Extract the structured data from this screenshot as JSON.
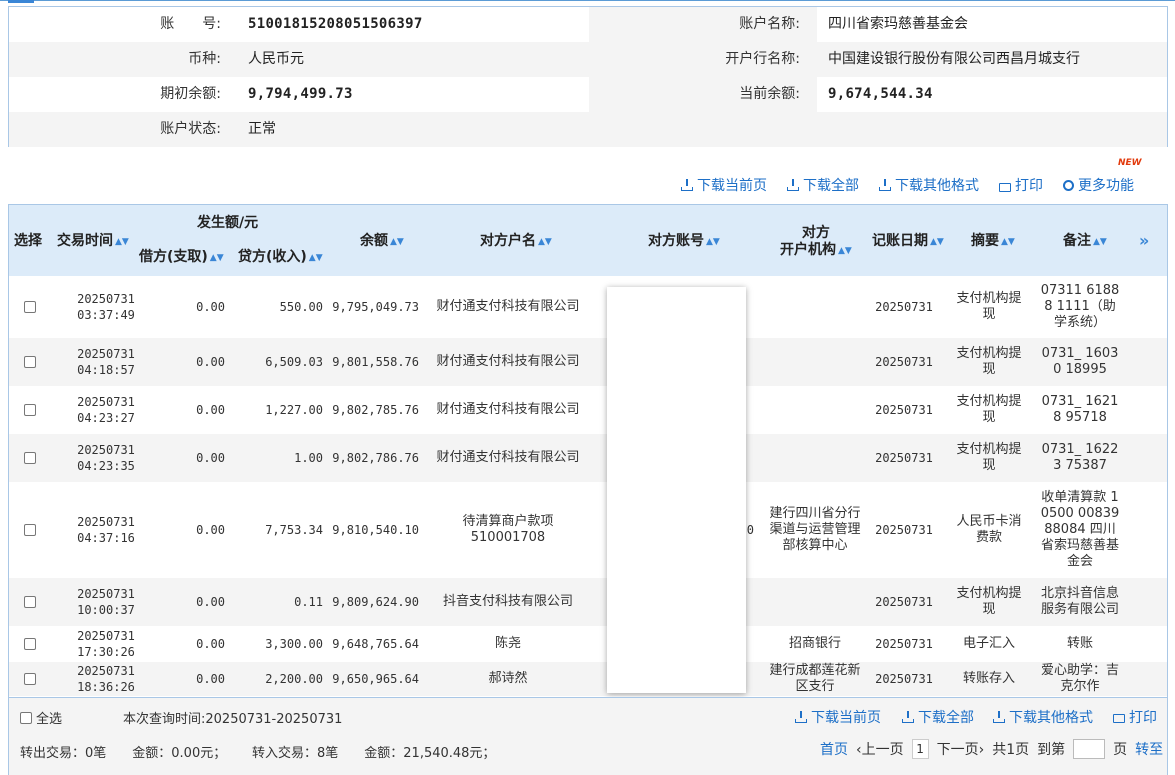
{
  "account": {
    "account_no_label": "账　　号:",
    "account_no": "510018152080515063​97",
    "account_name_label": "账户名称:",
    "account_name": "四川省索玛慈善基金会",
    "currency_label": "币种:",
    "currency": "人民币元",
    "bank_label": "开户行名称:",
    "bank": "中国建设银行股份有限公司西昌月城支行",
    "opening_label": "期初余额:",
    "opening": "9,794,499.73",
    "current_label": "当前余额:",
    "current": "9,674,544.34",
    "status_label": "账户状态:",
    "status": "正常"
  },
  "toolbar": {
    "download_page": "下载当前页",
    "download_all": "下载全部",
    "download_other": "下载其他格式",
    "print": "打印",
    "more": "更多功能",
    "new_badge": "NEW"
  },
  "table": {
    "headers": {
      "select": "选择",
      "time": "交易时间",
      "amount_group": "发生额/元",
      "debit": "借方(支取)",
      "credit": "贷方(收入)",
      "balance": "余额",
      "counterparty": "对方户名",
      "cp_account": "对方账号",
      "cp_bank_line1": "对方",
      "cp_bank_line2": "开户机构",
      "date": "记账日期",
      "summary": "摘要",
      "remark": "备注",
      "sort_glyph": "▲▼",
      "expand": "»"
    },
    "rows": [
      {
        "date": "20250731",
        "time": "03:37:49",
        "debit": "0.00",
        "credit": "550.00",
        "balance": "9,795,049.73",
        "counterparty": "财付通支付科技有限公司",
        "bank": "",
        "book_date": "20250731",
        "summary": "支付机构提现",
        "remark": "07311 61888 1111（助学系统）"
      },
      {
        "date": "20250731",
        "time": "04:18:57",
        "debit": "0.00",
        "credit": "6,509.03",
        "balance": "9,801,558.76",
        "counterparty": "财付通支付科技有限公司",
        "bank": "",
        "book_date": "20250731",
        "summary": "支付机构提现",
        "remark": "0731_ 16030 18995"
      },
      {
        "date": "20250731",
        "time": "04:23:27",
        "debit": "0.00",
        "credit": "1,227.00",
        "balance": "9,802,785.76",
        "counterparty": "财付通支付科技有限公司",
        "bank": "",
        "book_date": "20250731",
        "summary": "支付机构提现",
        "remark": "0731_ 16218 95718"
      },
      {
        "date": "20250731",
        "time": "04:23:35",
        "debit": "0.00",
        "credit": "1.00",
        "balance": "9,802,786.76",
        "counterparty": "财付通支付科技有限公司",
        "bank": "",
        "book_date": "20250731",
        "summary": "支付机构提现",
        "remark": "0731_ 16223 75387"
      },
      {
        "date": "20250731",
        "time": "04:37:16",
        "debit": "0.00",
        "credit": "7,753.34",
        "balance": "9,810,540.10",
        "counterparty": "待清算商户款项510001708",
        "bank": "建行四川省分行渠道与运营管理部核算中心",
        "book_date": "20250731",
        "summary": "人民币卡消费款",
        "remark": "收单清算款 10500 00839 88084 四川省索玛慈善基金会",
        "cp_account_tail": "0"
      },
      {
        "date": "20250731",
        "time": "10:00:37",
        "debit": "0.00",
        "credit": "0.11",
        "balance": "9,809,624.90",
        "counterparty": "抖音支付科技有限公司",
        "bank": "",
        "book_date": "20250731",
        "summary": "支付机构提现",
        "remark": "北京抖音信息服务有限公司"
      },
      {
        "date": "20250731",
        "time": "17:30:26",
        "debit": "0.00",
        "credit": "3,300.00",
        "balance": "9,648,765.64",
        "counterparty": "陈尧",
        "bank": "招商银行",
        "book_date": "20250731",
        "summary": "电子汇入",
        "remark": "转账"
      },
      {
        "date": "20250731",
        "time": "18:36:26",
        "debit": "0.00",
        "credit": "2,200.00",
        "balance": "9,650,965.64",
        "counterparty": "郝诗然",
        "bank": "建行成都莲花新区支行",
        "book_date": "20250731",
        "summary": "转账存入",
        "remark": "爱心助学：吉克尔作"
      }
    ]
  },
  "footer": {
    "select_all": "全选",
    "query_time": "本次查询时间:20250731-20250731",
    "download_page": "下载当前页",
    "download_all": "下载全部",
    "download_other": "下载其他格式",
    "print": "打印",
    "out_summary": "转出交易：0笔　　金额：0.00元；",
    "in_summary": "转入交易：8笔　　金额：21,540.48元；",
    "first": "首页",
    "prev": "‹上一页",
    "page_no": "1",
    "next": "下一页›",
    "total": "共1页",
    "goto": "到第",
    "page_unit": "页",
    "go": "转至"
  }
}
